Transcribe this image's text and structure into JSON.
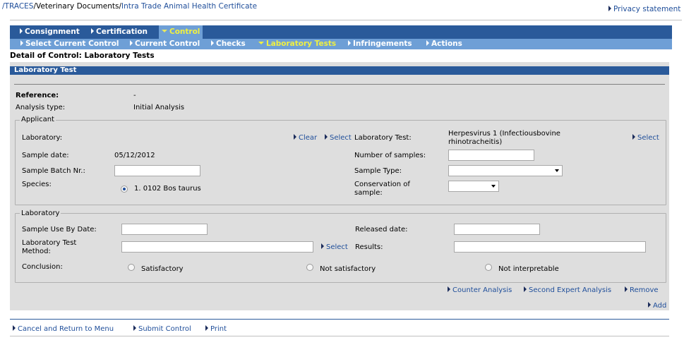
{
  "breadcrumb": {
    "root": "/TRACES",
    "sep1": "/",
    "section": "Veterinary Documents",
    "sep2": "/",
    "page": "Intra Trade Animal Health Certificate"
  },
  "privacy_link": "Privacy statement",
  "menu_primary": [
    {
      "label": "Consignment"
    },
    {
      "label": "Certification"
    },
    {
      "label": "Control"
    }
  ],
  "menu_secondary": [
    {
      "label": "Select Current Control"
    },
    {
      "label": "Current Control"
    },
    {
      "label": "Checks"
    },
    {
      "label": "Laboratory Tests"
    },
    {
      "label": "Infringements"
    },
    {
      "label": "Actions"
    }
  ],
  "detail_title": "Detail of Control: Laboratory Tests",
  "section_title": "Laboratory Test",
  "reference": {
    "label": "Reference:",
    "value": "-"
  },
  "analysis_type": {
    "label": "Analysis type:",
    "value": "Initial Analysis"
  },
  "applicant": {
    "legend": "Applicant",
    "laboratory_label": "Laboratory:",
    "clear_link": "Clear",
    "select_link": "Select",
    "lab_test_label": "Laboratory Test:",
    "lab_test_value_line1": "Herpesvirus 1 (Infectiousbovine",
    "lab_test_value_line2": "rhinotracheitis)",
    "lab_test_select": "Select",
    "sample_date_label": "Sample date:",
    "sample_date_value": "05/12/2012",
    "num_samples_label": "Number of samples:",
    "num_samples_value": "",
    "batch_label": "Sample Batch Nr.:",
    "batch_value": "",
    "sample_type_label": "Sample Type:",
    "sample_type_value": "",
    "species_label": "Species:",
    "species_option": "1. 0102 Bos taurus",
    "conservation_label_line1": "Conservation of",
    "conservation_label_line2": "sample:",
    "conservation_value": ""
  },
  "laboratory": {
    "legend": "Laboratory",
    "use_by_label": "Sample Use By Date:",
    "use_by_value": "",
    "released_label": "Released date:",
    "released_value": "",
    "method_label_line1": "Laboratory Test",
    "method_label_line2": "Method:",
    "method_value": "",
    "method_select": "Select",
    "results_label": "Results:",
    "results_value": "",
    "conclusion_label": "Conclusion:",
    "conclusion_options": [
      "Satisfactory",
      "Not satisfactory",
      "Not interpretable"
    ]
  },
  "analysis_links": {
    "counter": "Counter Analysis",
    "second": "Second Expert Analysis",
    "remove": "Remove",
    "add": "Add"
  },
  "footer_links": {
    "cancel": "Cancel and Return to Menu",
    "submit": "Submit Control",
    "print": "Print"
  },
  "colors": {
    "menu_dark": "#2a5a9a",
    "menu_light": "#6e9fd6",
    "active_text": "#f0f040",
    "link": "#1f4e9a",
    "panel": "#dedede"
  }
}
